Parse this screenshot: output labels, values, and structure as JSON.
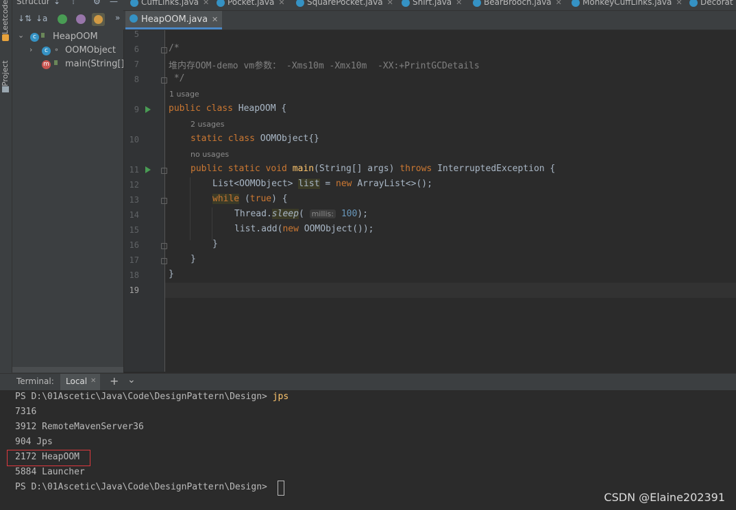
{
  "left_strip": {
    "top_label": "Leetcode",
    "project_label": "Project"
  },
  "structure": {
    "title": "Structur",
    "tree": [
      {
        "label": "HeapOOM"
      },
      {
        "label": "OOMObject"
      },
      {
        "label": "main(String[]):"
      }
    ]
  },
  "top_tabs": [
    "CuffLinks.java",
    "Pocket.java",
    "SquarePocket.java",
    "Shirt.java",
    "BearBrooch.java",
    "MonkeyCuffLinks.java",
    "Decorat"
  ],
  "active_tab": {
    "label": "HeapOOM.java"
  },
  "editor": {
    "line_numbers": [
      "5",
      "6",
      "7",
      "8",
      "9",
      "10",
      "11",
      "12",
      "13",
      "14",
      "15",
      "16",
      "17",
      "18",
      "19"
    ],
    "comment_open": "/*",
    "comment_text": "堆内存OOM-demo vm参数： -Xms10m -Xmx10m  -XX:+PrintGCDetails",
    "comment_close": " */",
    "usage_1": "1 usage",
    "usage_2": "2 usages",
    "usage_3": "no usages",
    "param_hint": "millis:",
    "sleep_value": "100"
  },
  "terminal": {
    "title": "Terminal:",
    "tab": "Local",
    "lines": [
      {
        "prompt": "PS D:\\01Ascetic\\Java\\Code\\DesignPattern\\Design> ",
        "cmd": "jps"
      },
      {
        "text": "7316"
      },
      {
        "text": "3912 RemoteMavenServer36"
      },
      {
        "text": "904 Jps"
      },
      {
        "text": "2172 HeapOOM"
      },
      {
        "text": "5884 Launcher"
      },
      {
        "prompt": "PS D:\\01Ascetic\\Java\\Code\\DesignPattern\\Design> "
      }
    ]
  },
  "watermark": "CSDN @Elaine202391"
}
